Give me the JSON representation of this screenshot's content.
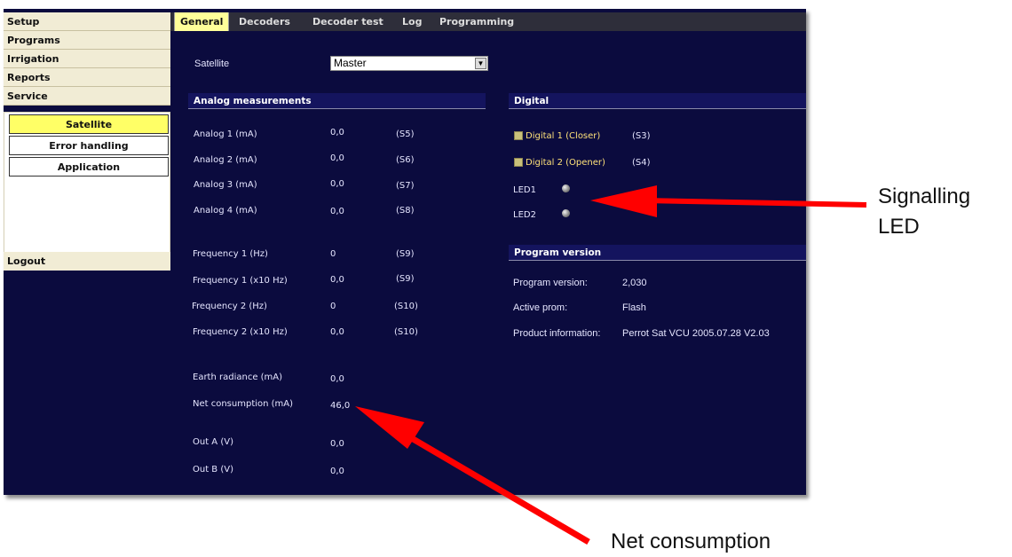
{
  "sidebar": {
    "items": [
      "Setup",
      "Programs",
      "Irrigation",
      "Reports",
      "Service"
    ],
    "sub_items": [
      "Satellite",
      "Error handling",
      "Application"
    ],
    "logout": "Logout"
  },
  "tabs": [
    "General",
    "Decoders",
    "Decoder test",
    "Log",
    "Programming"
  ],
  "satellite": {
    "label": "Satellite",
    "selected": "Master"
  },
  "analog": {
    "title": "Analog measurements",
    "rows": [
      {
        "label": "Analog 1 (mA)",
        "value": "0,0",
        "code": "(S5)"
      },
      {
        "label": "Analog 2 (mA)",
        "value": "0,0",
        "code": "(S6)"
      },
      {
        "label": "Analog 3 (mA)",
        "value": "0,0",
        "code": "(S7)"
      },
      {
        "label": "Analog 4 (mA)",
        "value": "0,0",
        "code": "(S8)"
      },
      {
        "label": "Frequency 1 (Hz)",
        "value": "0",
        "code": "(S9)"
      },
      {
        "label": "Frequency 1 (x10 Hz)",
        "value": "0,0",
        "code": "(S9)"
      },
      {
        "label": "Frequency 2 (Hz)",
        "value": "0",
        "code": "(S10)"
      },
      {
        "label": "Frequency 2 (x10 Hz)",
        "value": "0,0",
        "code": "(S10)"
      },
      {
        "label": "Earth radiance (mA)",
        "value": "0,0"
      },
      {
        "label": "Net consumption (mA)",
        "value": "46,0"
      },
      {
        "label": "Out A (V)",
        "value": "0,0"
      },
      {
        "label": "Out B (V)",
        "value": "0,0"
      }
    ]
  },
  "digital": {
    "title": "Digital",
    "inputs": [
      {
        "label": "Digital 1 (Closer)",
        "code": "(S3)"
      },
      {
        "label": "Digital 2 (Opener)",
        "code": "(S4)"
      }
    ],
    "leds": [
      "LED1",
      "LED2"
    ]
  },
  "program_version": {
    "title": "Program version",
    "rows": [
      {
        "label": "Program version:",
        "value": "2,030"
      },
      {
        "label": "Active prom:",
        "value": "Flash"
      },
      {
        "label": "Product information:",
        "value": "Perrot Sat VCU 2005.07.28 V2.03"
      }
    ]
  },
  "annotations": {
    "signalling_led": [
      "Signalling",
      "LED"
    ],
    "net_consumption": "Net consumption",
    "arrow_color": "#ff0000"
  }
}
